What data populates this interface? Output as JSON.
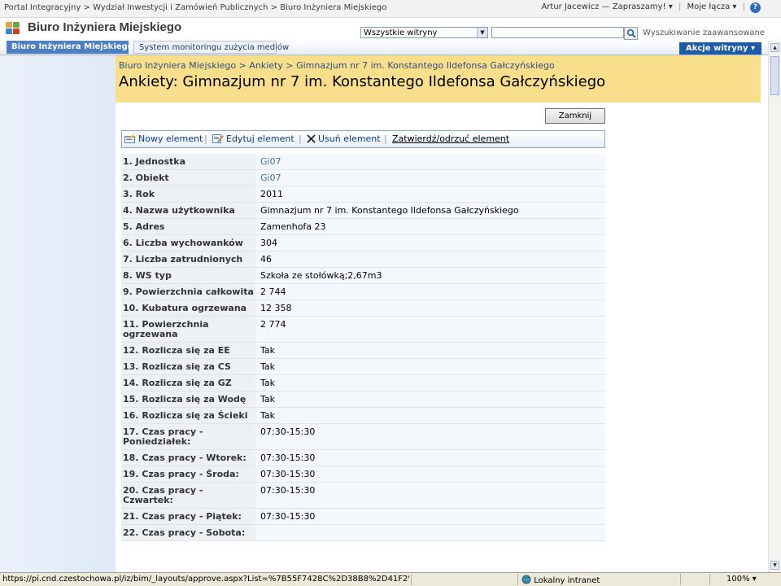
{
  "topbar": {
    "crumb_items": [
      "Portal Integracyjny",
      "Wydział Inwestycji i Zamówień Publicznych",
      "Biuro Inżyniera Miejskiego"
    ],
    "crumb_separator": ">",
    "user_menu": "Artur Jacewicz — Zapraszamy!",
    "my_links": "Moje łącza"
  },
  "header": {
    "site_title": "Biuro Inżyniera Miejskiego",
    "search_scope": "Wszystkie witryny",
    "search_value": "",
    "advanced_search": "Wyszukiwanie zaawansowane"
  },
  "nav": {
    "tabs": [
      {
        "label": "Biuro Inżyniera Miejskiego",
        "active": true
      },
      {
        "label": "System monitoringu zużycia mediów",
        "active": false
      }
    ],
    "site_actions": "Akcje witryny"
  },
  "page": {
    "breadcrumb": "Biuro Inżyniera Miejskiego > Ankiety > Gimnazjum nr 7 im. Konstantego Ildefonsa Gałczyńskiego",
    "title": "Ankiety: Gimnazjum nr 7 im. Konstantego Ildefonsa Gałczyńskiego",
    "close_button": "Zamknij"
  },
  "toolbar": {
    "new_item": "Nowy element",
    "edit_item": "Edytuj element",
    "delete_item": "Usuń element",
    "approve_item": "Zatwierdź/odrzuć element"
  },
  "fields": [
    {
      "label": "1. Jednostka",
      "value": "Gi07",
      "link": true
    },
    {
      "label": "2. Obiekt",
      "value": "Gi07",
      "link": true
    },
    {
      "label": "3. Rok",
      "value": "2011"
    },
    {
      "label": "4. Nazwa użytkownika",
      "value": "Gimnazjum nr 7  im. Konstantego Ildefonsa Gałczyńskiego"
    },
    {
      "label": "5. Adres",
      "value": "Zamenhofa 23"
    },
    {
      "label": "6. Liczba wychowanków",
      "value": "304"
    },
    {
      "label": "7. Liczba zatrudnionych",
      "value": "46"
    },
    {
      "label": "8. WS typ",
      "value": "Szkoła ze stołówką;2,67m3"
    },
    {
      "label": "9. Powierzchnia całkowita",
      "value": "2 744"
    },
    {
      "label": "10. Kubatura ogrzewana",
      "value": "12 358"
    },
    {
      "label": "11. Powierzchnia ogrzewana",
      "value": "2 774"
    },
    {
      "label": "12. Rozlicza się za EE",
      "value": "Tak"
    },
    {
      "label": "13. Rozlicza się za CS",
      "value": "Tak"
    },
    {
      "label": "14. Rozlicza się za GZ",
      "value": "Tak"
    },
    {
      "label": "15. Rozlicza się za Wodę",
      "value": "Tak"
    },
    {
      "label": "16. Rozlicza się za Ścieki",
      "value": "Tak"
    },
    {
      "label": "17. Czas pracy - Poniedziałek:",
      "value": "07:30-15:30"
    },
    {
      "label": "18. Czas pracy - Wtorek:",
      "value": "07:30-15:30"
    },
    {
      "label": "19. Czas pracy - Środa:",
      "value": "07:30-15:30"
    },
    {
      "label": "20. Czas pracy - Czwartek:",
      "value": "07:30-15:30"
    },
    {
      "label": "21. Czas pracy - Piątek:",
      "value": "07:30-15:30"
    },
    {
      "label": "22. Czas pracy - Sobota:",
      "value": ""
    }
  ],
  "statusbar": {
    "url": "https://pi.cnd.czestochowa.pl/iz/bim/_layouts/approve.aspx?List=%7B55F7428C%2D38B8%2D41F2%2D9F1E",
    "zone": "Lokalny intranet",
    "zoom": "100%"
  },
  "colors": {
    "accent": "#4d7fc2",
    "header_band": "#f9df8c",
    "site_actions_bg": "#1f5aa6"
  },
  "icons": [
    "sharepoint-logo-icon",
    "search-icon",
    "help-icon",
    "new-item-icon",
    "edit-item-icon",
    "delete-icon",
    "globe-icon"
  ]
}
